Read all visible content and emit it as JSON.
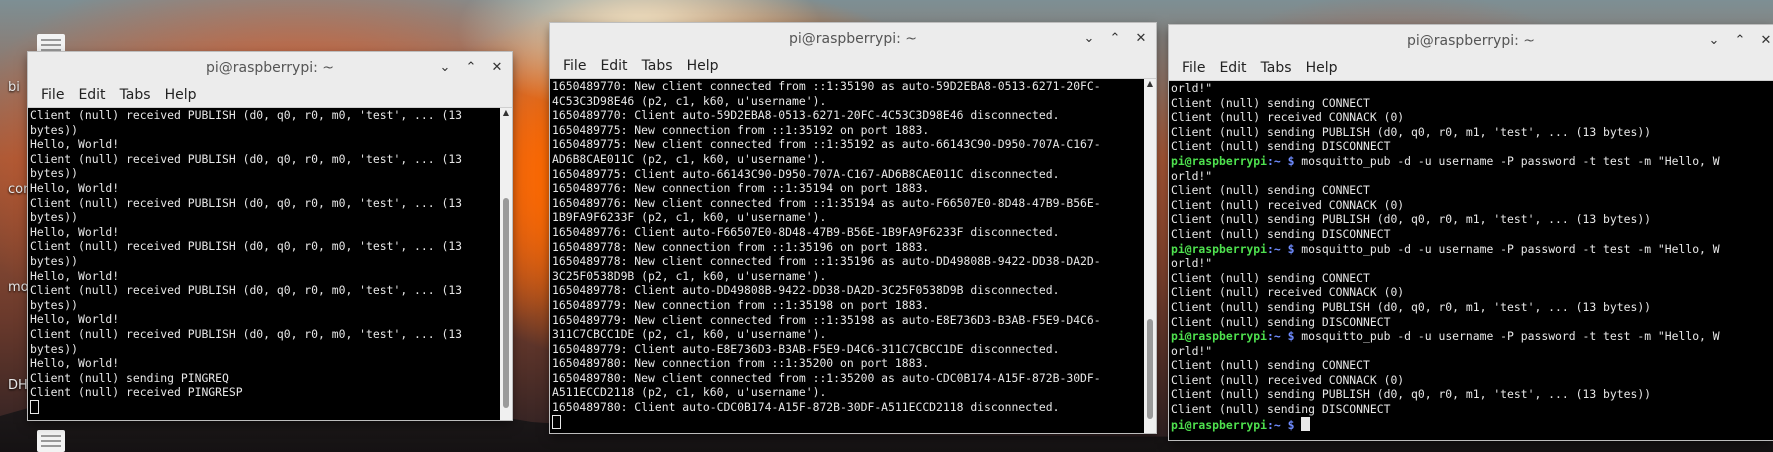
{
  "desktop": {
    "labels": [
      "bi",
      "con",
      "mo",
      "DHC"
    ]
  },
  "windows": [
    {
      "title": "pi@raspberrypi: ~",
      "menu": [
        "File",
        "Edit",
        "Tabs",
        "Help"
      ],
      "lines": [
        "Client (null) received PUBLISH (d0, q0, r0, m0, 'test', ... (13",
        "bytes))",
        "Hello, World!",
        "Client (null) received PUBLISH (d0, q0, r0, m0, 'test', ... (13",
        "bytes))",
        "Hello, World!",
        "Client (null) received PUBLISH (d0, q0, r0, m0, 'test', ... (13",
        "bytes))",
        "Hello, World!",
        "Client (null) received PUBLISH (d0, q0, r0, m0, 'test', ... (13",
        "bytes))",
        "Hello, World!",
        "Client (null) received PUBLISH (d0, q0, r0, m0, 'test', ... (13",
        "bytes))",
        "Hello, World!",
        "Client (null) received PUBLISH (d0, q0, r0, m0, 'test', ... (13",
        "bytes))",
        "Hello, World!",
        "Client (null) sending PINGREQ",
        "Client (null) received PINGRESP"
      ]
    },
    {
      "title": "pi@raspberrypi: ~",
      "menu": [
        "File",
        "Edit",
        "Tabs",
        "Help"
      ],
      "lines": [
        "1650489770: New client connected from ::1:35190 as auto-59D2EBA8-0513-6271-20FC-",
        "4C53C3D98E46 (p2, c1, k60, u'username').",
        "1650489770: Client auto-59D2EBA8-0513-6271-20FC-4C53C3D98E46 disconnected.",
        "1650489775: New connection from ::1:35192 on port 1883.",
        "1650489775: New client connected from ::1:35192 as auto-66143C90-D950-707A-C167-",
        "AD6B8CAE011C (p2, c1, k60, u'username').",
        "1650489775: Client auto-66143C90-D950-707A-C167-AD6B8CAE011C disconnected.",
        "1650489776: New connection from ::1:35194 on port 1883.",
        "1650489776: New client connected from ::1:35194 as auto-F66507E0-8D48-47B9-B56E-",
        "1B9FA9F6233F (p2, c1, k60, u'username').",
        "1650489776: Client auto-F66507E0-8D48-47B9-B56E-1B9FA9F6233F disconnected.",
        "1650489778: New connection from ::1:35196 on port 1883.",
        "1650489778: New client connected from ::1:35196 as auto-DD49808B-9422-DD38-DA2D-",
        "3C25F0538D9B (p2, c1, k60, u'username').",
        "1650489778: Client auto-DD49808B-9422-DD38-DA2D-3C25F0538D9B disconnected.",
        "1650489779: New connection from ::1:35198 on port 1883.",
        "1650489779: New client connected from ::1:35198 as auto-E8E736D3-B3AB-F5E9-D4C6-",
        "311C7CBCC1DE (p2, c1, k60, u'username').",
        "1650489779: Client auto-E8E736D3-B3AB-F5E9-D4C6-311C7CBCC1DE disconnected.",
        "1650489780: New connection from ::1:35200 on port 1883.",
        "1650489780: New client connected from ::1:35200 as auto-CDC0B174-A15F-872B-30DF-",
        "A511ECCD2118 (p2, c1, k60, u'username').",
        "1650489780: Client auto-CDC0B174-A15F-872B-30DF-A511ECCD2118 disconnected."
      ]
    },
    {
      "title": "pi@raspberrypi: ~",
      "menu": [
        "File",
        "Edit",
        "Tabs",
        "Help"
      ],
      "prompt_user": "pi@raspberrypi",
      "prompt_path": ":~ $",
      "command": " mosquitto_pub -d -u username -P password -t test -m \"Hello, W",
      "lines": [
        {
          "t": "orld!\""
        },
        {
          "t": "Client (null) sending CONNECT"
        },
        {
          "t": "Client (null) received CONNACK (0)"
        },
        {
          "t": "Client (null) sending PUBLISH (d0, q0, r0, m1, 'test', ... (13 bytes))"
        },
        {
          "t": "Client (null) sending DISCONNECT"
        },
        {
          "p": true
        },
        {
          "t": "orld!\""
        },
        {
          "t": "Client (null) sending CONNECT"
        },
        {
          "t": "Client (null) received CONNACK (0)"
        },
        {
          "t": "Client (null) sending PUBLISH (d0, q0, r0, m1, 'test', ... (13 bytes))"
        },
        {
          "t": "Client (null) sending DISCONNECT"
        },
        {
          "p": true
        },
        {
          "t": "orld!\""
        },
        {
          "t": "Client (null) sending CONNECT"
        },
        {
          "t": "Client (null) received CONNACK (0)"
        },
        {
          "t": "Client (null) sending PUBLISH (d0, q0, r0, m1, 'test', ... (13 bytes))"
        },
        {
          "t": "Client (null) sending DISCONNECT"
        },
        {
          "p": true
        },
        {
          "t": "orld!\""
        },
        {
          "t": "Client (null) sending CONNECT"
        },
        {
          "t": "Client (null) received CONNACK (0)"
        },
        {
          "t": "Client (null) sending PUBLISH (d0, q0, r0, m1, 'test', ... (13 bytes))"
        },
        {
          "t": "Client (null) sending DISCONNECT"
        },
        {
          "p": true,
          "final": true
        }
      ]
    }
  ]
}
